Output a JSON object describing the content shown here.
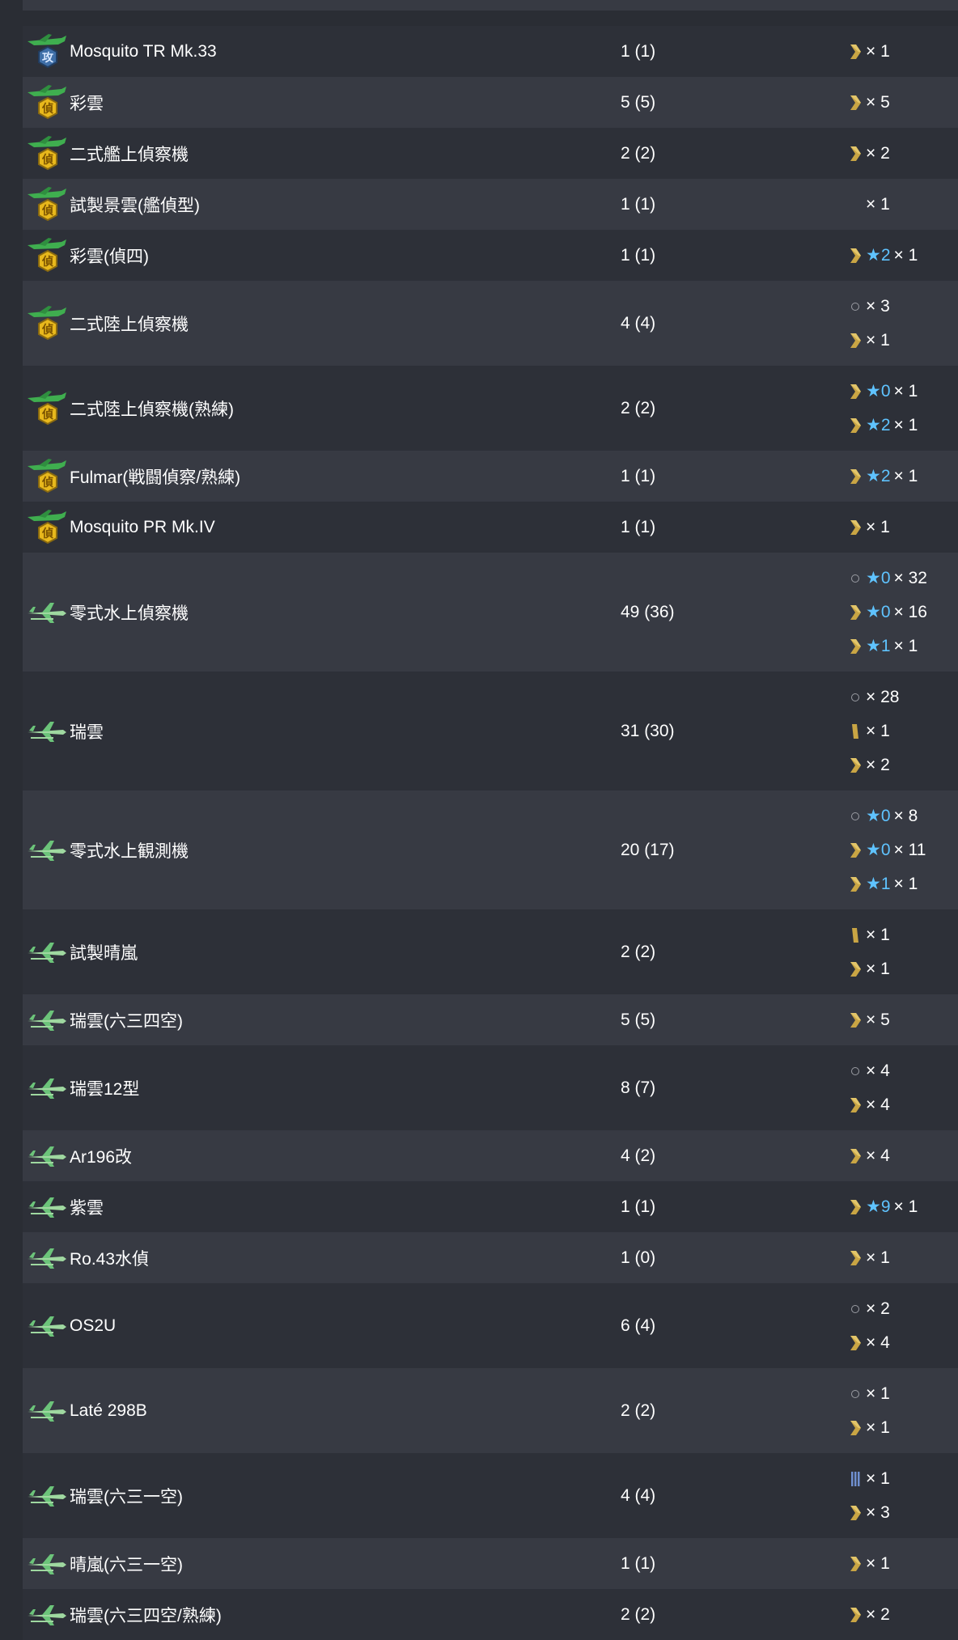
{
  "rows": [
    {
      "name": "Mosquito TR Mk.33",
      "icon": "attacker-plane-icon",
      "count": "1 (1)",
      "prof": [
        {
          "mark": "chevron",
          "star": "",
          "count": "× 1"
        }
      ]
    },
    {
      "name": "彩雲",
      "icon": "recon-plane-icon",
      "count": "5 (5)",
      "prof": [
        {
          "mark": "chevron",
          "star": "",
          "count": "× 5"
        }
      ]
    },
    {
      "name": "二式艦上偵察機",
      "icon": "recon-plane-icon",
      "count": "2 (2)",
      "prof": [
        {
          "mark": "chevron",
          "star": "",
          "count": "× 2"
        }
      ]
    },
    {
      "name": "試製景雲(艦偵型)",
      "icon": "recon-plane-icon",
      "count": "1 (1)",
      "prof": [
        {
          "mark": "none",
          "star": "",
          "count": "× 1"
        }
      ]
    },
    {
      "name": "彩雲(偵四)",
      "icon": "recon-plane-icon",
      "count": "1 (1)",
      "prof": [
        {
          "mark": "chevron",
          "star": "★2",
          "count": "× 1"
        }
      ]
    },
    {
      "name": "二式陸上偵察機",
      "icon": "recon-plane-icon",
      "count": "4 (4)",
      "prof": [
        {
          "mark": "circle",
          "star": "",
          "count": "× 3"
        },
        {
          "mark": "chevron",
          "star": "",
          "count": "× 1"
        }
      ]
    },
    {
      "name": "二式陸上偵察機(熟練)",
      "icon": "recon-plane-icon",
      "count": "2 (2)",
      "prof": [
        {
          "mark": "chevron",
          "star": "★0",
          "count": "× 1"
        },
        {
          "mark": "chevron",
          "star": "★2",
          "count": "× 1"
        }
      ]
    },
    {
      "name": "Fulmar(戦闘偵察/熟練)",
      "icon": "recon-plane-icon",
      "count": "1 (1)",
      "prof": [
        {
          "mark": "chevron",
          "star": "★2",
          "count": "× 1"
        }
      ]
    },
    {
      "name": "Mosquito PR Mk.IV",
      "icon": "recon-plane-icon",
      "count": "1 (1)",
      "prof": [
        {
          "mark": "chevron",
          "star": "",
          "count": "× 1"
        }
      ]
    },
    {
      "name": "零式水上偵察機",
      "icon": "seaplane-icon",
      "count": "49 (36)",
      "prof": [
        {
          "mark": "circle",
          "star": "★0",
          "count": "× 32"
        },
        {
          "mark": "chevron",
          "star": "★0",
          "count": "× 16"
        },
        {
          "mark": "chevron",
          "star": "★1",
          "count": "× 1"
        }
      ]
    },
    {
      "name": "瑞雲",
      "icon": "seaplane-icon",
      "count": "31 (30)",
      "prof": [
        {
          "mark": "circle",
          "star": "",
          "count": "× 28"
        },
        {
          "mark": "bar",
          "star": "",
          "count": "× 1"
        },
        {
          "mark": "chevron",
          "star": "",
          "count": "× 2"
        }
      ]
    },
    {
      "name": "零式水上観測機",
      "icon": "seaplane-icon",
      "count": "20 (17)",
      "prof": [
        {
          "mark": "circle",
          "star": "★0",
          "count": "× 8"
        },
        {
          "mark": "chevron",
          "star": "★0",
          "count": "× 11"
        },
        {
          "mark": "chevron",
          "star": "★1",
          "count": "× 1"
        }
      ]
    },
    {
      "name": "試製晴嵐",
      "icon": "seaplane-icon",
      "count": "2 (2)",
      "prof": [
        {
          "mark": "bar",
          "star": "",
          "count": "× 1"
        },
        {
          "mark": "chevron",
          "star": "",
          "count": "× 1"
        }
      ]
    },
    {
      "name": "瑞雲(六三四空)",
      "icon": "seaplane-icon",
      "count": "5 (5)",
      "prof": [
        {
          "mark": "chevron",
          "star": "",
          "count": "× 5"
        }
      ]
    },
    {
      "name": "瑞雲12型",
      "icon": "seaplane-icon",
      "count": "8 (7)",
      "prof": [
        {
          "mark": "circle",
          "star": "",
          "count": "× 4"
        },
        {
          "mark": "chevron",
          "star": "",
          "count": "× 4"
        }
      ]
    },
    {
      "name": "Ar196改",
      "icon": "seaplane-icon",
      "count": "4 (2)",
      "prof": [
        {
          "mark": "chevron",
          "star": "",
          "count": "× 4"
        }
      ]
    },
    {
      "name": "紫雲",
      "icon": "seaplane-icon",
      "count": "1 (1)",
      "prof": [
        {
          "mark": "chevron",
          "star": "★9",
          "count": "× 1"
        }
      ]
    },
    {
      "name": "Ro.43水偵",
      "icon": "seaplane-icon",
      "count": "1 (0)",
      "prof": [
        {
          "mark": "chevron",
          "star": "",
          "count": "× 1"
        }
      ]
    },
    {
      "name": "OS2U",
      "icon": "seaplane-icon",
      "count": "6 (4)",
      "prof": [
        {
          "mark": "circle",
          "star": "",
          "count": "× 2"
        },
        {
          "mark": "chevron",
          "star": "",
          "count": "× 4"
        }
      ]
    },
    {
      "name": "Laté 298B",
      "icon": "seaplane-icon",
      "count": "2 (2)",
      "prof": [
        {
          "mark": "circle",
          "star": "",
          "count": "× 1"
        },
        {
          "mark": "chevron",
          "star": "",
          "count": "× 1"
        }
      ]
    },
    {
      "name": "瑞雲(六三一空)",
      "icon": "seaplane-icon",
      "count": "4 (4)",
      "prof": [
        {
          "mark": "triple-bar",
          "star": "",
          "count": "× 1"
        },
        {
          "mark": "chevron",
          "star": "",
          "count": "× 3"
        }
      ]
    },
    {
      "name": "晴嵐(六三一空)",
      "icon": "seaplane-icon",
      "count": "1 (1)",
      "prof": [
        {
          "mark": "chevron",
          "star": "",
          "count": "× 1"
        }
      ]
    },
    {
      "name": "瑞雲(六三四空/熟練)",
      "icon": "seaplane-icon",
      "count": "2 (2)",
      "prof": [
        {
          "mark": "chevron",
          "star": "",
          "count": "× 2"
        }
      ]
    }
  ],
  "icon_badges": {
    "attacker": "攻",
    "recon": "偵"
  },
  "colors": {
    "background": "#2a2d34",
    "row_dark": "#2d3038",
    "row_light": "#373a43",
    "star": "#5fc3ff",
    "chevron": "#c9a544",
    "plane_green": "#4fb65a"
  }
}
